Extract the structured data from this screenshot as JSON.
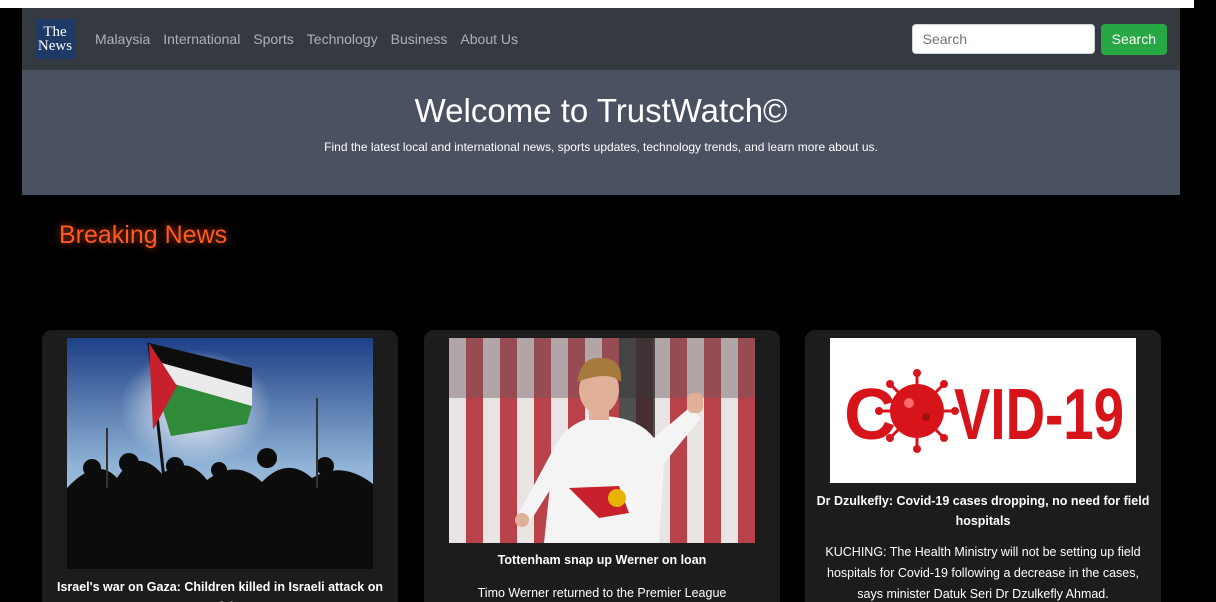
{
  "navbar": {
    "brand_line1": "The",
    "brand_line2": "News",
    "links": [
      "Malaysia",
      "International",
      "Sports",
      "Technology",
      "Business",
      "About Us"
    ],
    "search_placeholder": "Search",
    "search_button": "Search"
  },
  "hero": {
    "title": "Welcome to TrustWatch©",
    "subtitle": "Find the latest local and international news, sports updates, technology trends, and learn more about us."
  },
  "breaking": {
    "heading": "Breaking News"
  },
  "cards": [
    {
      "title": "Israel's war on Gaza: Children killed in Israeli attack on Rafah",
      "text": ""
    },
    {
      "title": "Tottenham snap up Werner on loan",
      "text": "Timo Werner returned to the Premier League"
    },
    {
      "title": "Dr Dzulkefly: Covid-19 cases dropping, no need for field hospitals",
      "text": "KUCHING: The Health Ministry will not be setting up field hospitals for Covid-19 following a decrease in the cases, says minister Datuk Seri Dr Dzulkefly Ahmad.",
      "image_text": "COVID-19"
    }
  ],
  "colors": {
    "navbar": "#343a40",
    "hero": "#4a5160",
    "accent_breaking": "#ff5a1f",
    "search_button": "#28a745",
    "card_bg": "#1c1c1c",
    "covid_red": "#d8141b"
  }
}
